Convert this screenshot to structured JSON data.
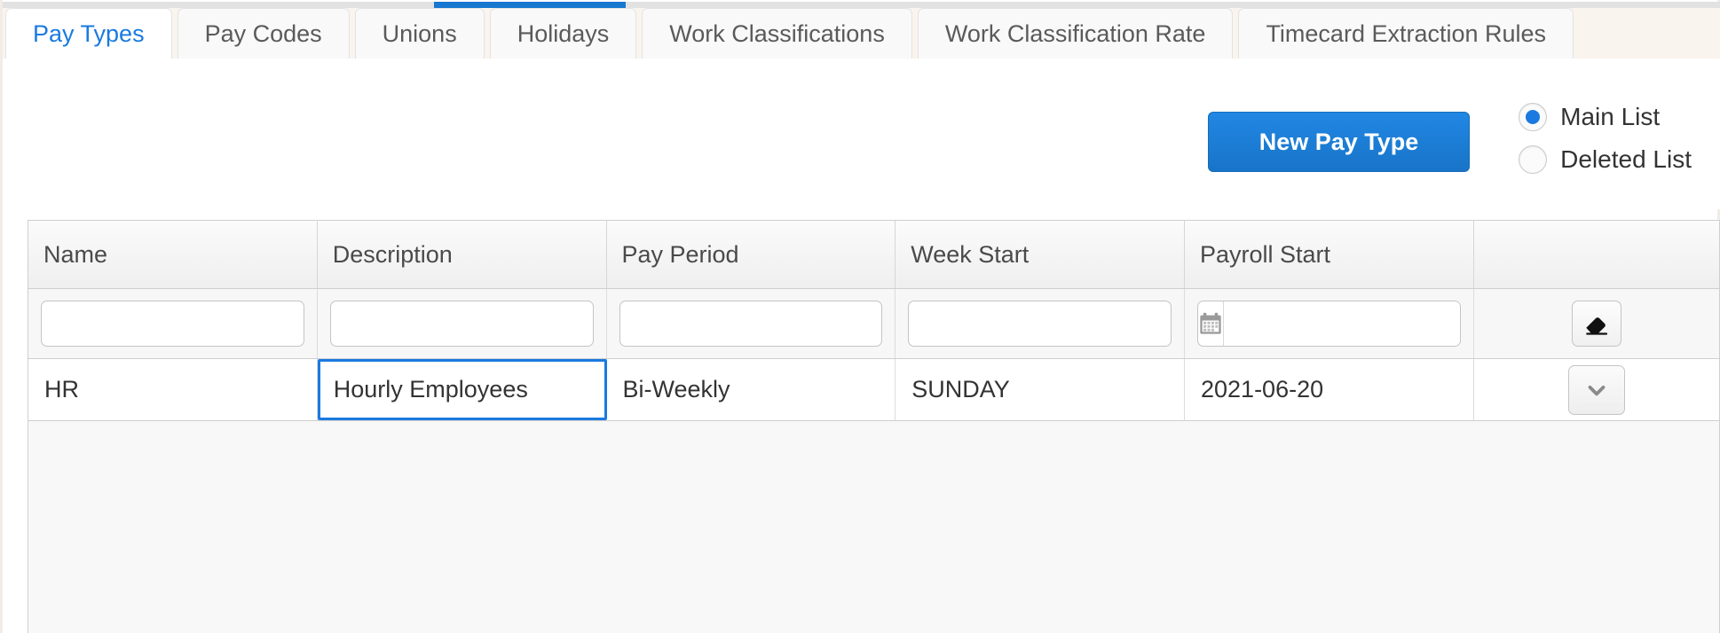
{
  "scrollbar": {
    "thumb_color": "#1878d0",
    "track_color": "#e2e2e2"
  },
  "tabs": [
    {
      "label": "Pay Types",
      "active": true
    },
    {
      "label": "Pay Codes",
      "active": false
    },
    {
      "label": "Unions",
      "active": false
    },
    {
      "label": "Holidays",
      "active": false
    },
    {
      "label": "Work Classifications",
      "active": false
    },
    {
      "label": "Work Classification Rate",
      "active": false
    },
    {
      "label": "Timecard Extraction Rules",
      "active": false
    }
  ],
  "toolbar": {
    "new_button_label": "New Pay Type",
    "new_button_color": "#1874c8",
    "list_options": [
      {
        "label": "Main List",
        "selected": true
      },
      {
        "label": "Deleted List",
        "selected": false
      }
    ]
  },
  "grid": {
    "columns": [
      {
        "header": "Name"
      },
      {
        "header": "Description"
      },
      {
        "header": "Pay Period"
      },
      {
        "header": "Week Start"
      },
      {
        "header": "Payroll Start"
      },
      {
        "header": ""
      }
    ],
    "filters": {
      "name": "",
      "name_placeholder": "",
      "description": "",
      "description_placeholder": "",
      "pay_period": "",
      "pay_period_placeholder": "",
      "week_start": "",
      "week_start_placeholder": "",
      "payroll_start": "",
      "payroll_start_placeholder": "",
      "calendar_icon": "calendar-icon",
      "clear_icon": "eraser-icon"
    },
    "rows": [
      {
        "name": "HR",
        "description": "Hourly Employees",
        "description_focused": true,
        "pay_period": "Bi-Weekly",
        "week_start": "SUNDAY",
        "payroll_start": "2021-06-20",
        "row_menu_icon": "chevron-down-icon"
      }
    ],
    "focus_color": "#1a7ae0"
  }
}
